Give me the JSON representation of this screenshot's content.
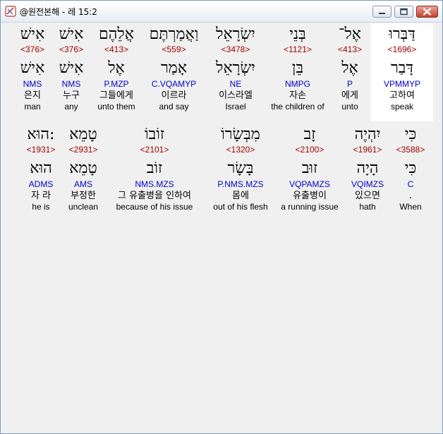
{
  "window": {
    "title": "@원전본해 - 레 15:2",
    "controls": [
      "minimize",
      "maximize",
      "close"
    ]
  },
  "verse_rows": [
    {
      "words": [
        {
          "hebrew": "דַּבְּרוּ",
          "strong": "<1696>",
          "lemma": "דָּבַר",
          "parsing": "VPMMYP",
          "korean": "고하여",
          "english": "speak",
          "highlighted": true
        },
        {
          "hebrew": "אֶל־",
          "strong": "<413>",
          "lemma": "אֶל",
          "parsing": "P",
          "korean": "에게",
          "english": "unto"
        },
        {
          "hebrew": "בְּנֵי",
          "strong": "<1121>",
          "lemma": "בֵּן",
          "parsing": "NMPG",
          "korean": "자손",
          "english": "the children of"
        },
        {
          "hebrew": "יִשְׂרָאֵל",
          "strong": "<3478>",
          "lemma": "יִשְׂרָאֵל",
          "parsing": "NE",
          "korean": "이스라엘",
          "english": "Israel"
        },
        {
          "hebrew": "וַאֲמַרְתֶּם",
          "strong": "<559>",
          "lemma": "אָמַר",
          "parsing": "C.VQAMYP",
          "korean": "이르라",
          "english": "and say"
        },
        {
          "hebrew": "אֲלֵהֶם",
          "strong": "<413>",
          "lemma": "אֶל",
          "parsing": "P.MZP",
          "korean": "그들에게",
          "english": "unto them"
        },
        {
          "hebrew": "אִישׁ",
          "strong": "<376>",
          "lemma": "אִישׁ",
          "parsing": "NMS",
          "korean": "누구",
          "english": "any"
        },
        {
          "hebrew": "אִישׁ",
          "strong": "<376>",
          "lemma": "אִישׁ",
          "parsing": "NMS",
          "korean": "은지",
          "english": "man"
        }
      ]
    },
    {
      "words": [
        {
          "hebrew": "כִּי",
          "strong": "<3588>",
          "lemma": "כִּי",
          "parsing": "C",
          "korean": ".",
          "english": "When"
        },
        {
          "hebrew": "יִהְיֶה",
          "strong": "<1961>",
          "lemma": "הָיָה",
          "parsing": "VQIMZS",
          "korean": "있으면",
          "english": "hath"
        },
        {
          "hebrew": "זָב",
          "strong": "<2100>",
          "lemma": "זוּב",
          "parsing": "VQPAMZS",
          "korean": "유출병이",
          "english": "a running issue"
        },
        {
          "hebrew": "מִבְּשָׂרוֹ",
          "strong": "<1320>",
          "lemma": "בָּשָׂר",
          "parsing": "P.NMS.MZS",
          "korean": "몸에",
          "english": "out of his flesh"
        },
        {
          "hebrew": "זוֹבוֹ",
          "strong": "<2101>",
          "lemma": "זוֹב",
          "parsing": "NMS.MZS",
          "korean": "그 유출병을 인하여",
          "english": "because of his issue"
        },
        {
          "hebrew": "טָמֵא",
          "strong": "<2931>",
          "lemma": "טָמֵא",
          "parsing": "AMS",
          "korean": "부정한",
          "english": "unclean"
        },
        {
          "hebrew": "הוּא:",
          "strong": "<1931>",
          "lemma": "הוּא",
          "parsing": "ADMS",
          "korean": "자 라",
          "english": "he is"
        }
      ]
    }
  ],
  "colors": {
    "strong_number": "#a00000",
    "parsing_code": "#0000c8",
    "highlight_background": "#ffffff",
    "panel_background": "#f0f0f0"
  }
}
